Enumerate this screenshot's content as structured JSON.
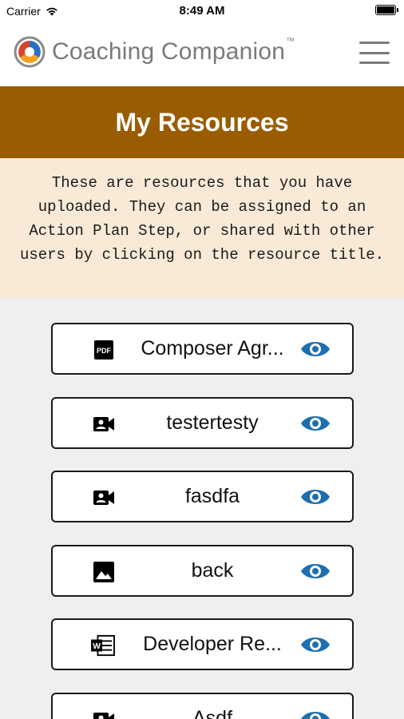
{
  "status_bar": {
    "carrier": "Carrier",
    "time": "8:49 AM"
  },
  "header": {
    "app_name": "Coaching Companion",
    "trademark": "™"
  },
  "banner": {
    "title": "My Resources"
  },
  "intro": {
    "text": "These are resources that you have uploaded. They can be assigned to an Action Plan Step, or shared with other users by clicking on the resource title."
  },
  "resources": [
    {
      "title": "Composer Agr...",
      "type_icon": "pdf-icon"
    },
    {
      "title": "testertesty",
      "type_icon": "video-icon"
    },
    {
      "title": "fasdfa",
      "type_icon": "video-icon"
    },
    {
      "title": "back",
      "type_icon": "image-icon"
    },
    {
      "title": "Developer Re...",
      "type_icon": "word-doc-icon"
    },
    {
      "title": "Asdf",
      "type_icon": "video-icon"
    }
  ],
  "colors": {
    "banner": "#9a5c00",
    "intro_bg": "#f9ead7",
    "eye_icon": "#1f6fad",
    "background": "#efefef"
  }
}
